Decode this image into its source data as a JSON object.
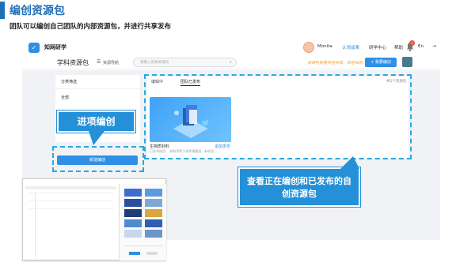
{
  "slide": {
    "title": "编创资源包",
    "subtitle": "团队可以编创自己团队的内部资源包，并进行共享发布"
  },
  "app": {
    "brand": "知网研学",
    "user_name": "Monita",
    "verify_link": "认领成果",
    "center_link": "研学中心",
    "help_link": "帮助",
    "lang": "En",
    "notification_count": "2",
    "library_title": "学科资源包",
    "nav_label": "资源导航",
    "search_placeholder": "请输入资源关键词",
    "promo_text": "资源包免费共创共享，欢迎体验！",
    "publish_button": "+ 我要编创",
    "category_title": "分类筛选",
    "category_all": "全部",
    "tab_editing": "编辑中",
    "tab_published": "团队已发布",
    "total": "共1个资源包",
    "resource_name": "生物质材料",
    "resource_add": "追加发布",
    "resource_desc": "已发布成员：   材料学院于老师课题组 · 有机化...",
    "new_button": "新建编创"
  },
  "callouts": {
    "enter_edit": "进项编创",
    "view_line1": "查看正在编创和已发布的自",
    "view_line2": "创资源包"
  },
  "colors": {
    "accent": "#2f8fe6",
    "callout": "#2490d8",
    "dashed_frame": "#28a9df",
    "title": "#1f6fb8"
  }
}
